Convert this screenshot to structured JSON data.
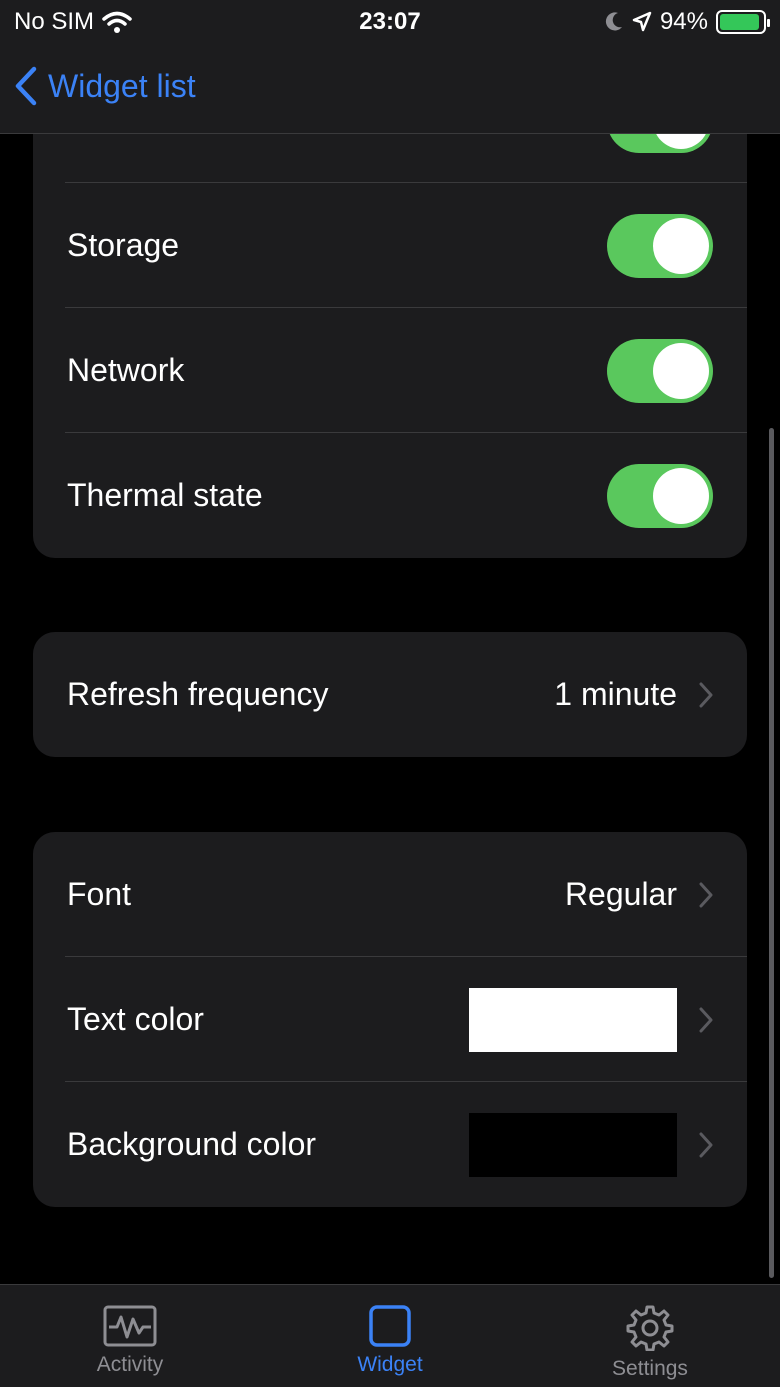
{
  "status_bar": {
    "carrier": "No SIM",
    "time": "23:07",
    "battery": "94%",
    "battery_level": 0.94
  },
  "nav": {
    "back_label": "Widget list"
  },
  "toggles_group": {
    "rows": [
      {
        "label": "Storage",
        "enabled": true
      },
      {
        "label": "Network",
        "enabled": true
      },
      {
        "label": "Thermal state",
        "enabled": true
      }
    ]
  },
  "refresh": {
    "label": "Refresh frequency",
    "value": "1 minute"
  },
  "appearance": {
    "font": {
      "label": "Font",
      "value": "Regular"
    },
    "text_color": {
      "label": "Text color",
      "swatch": "#ffffff"
    },
    "background_color": {
      "label": "Background color",
      "swatch": "#000000"
    }
  },
  "tabs": [
    {
      "label": "Activity",
      "icon": "activity-icon",
      "active": false
    },
    {
      "label": "Widget",
      "icon": "widget-icon",
      "active": true
    },
    {
      "label": "Settings",
      "icon": "gear-icon",
      "active": false
    }
  ],
  "colors": {
    "accent": "#3b82f6",
    "toggle_on": "#5ac85d",
    "group_bg": "#1c1c1e"
  }
}
